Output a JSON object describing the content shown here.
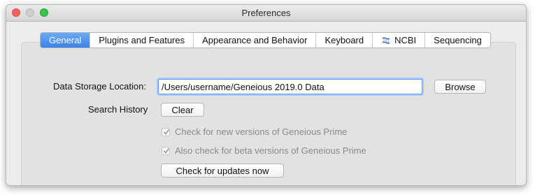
{
  "window": {
    "title": "Preferences"
  },
  "tabs": [
    {
      "label": "General",
      "active": true
    },
    {
      "label": "Plugins and Features",
      "active": false
    },
    {
      "label": "Appearance and Behavior",
      "active": false
    },
    {
      "label": "Keyboard",
      "active": false
    },
    {
      "label": "NCBI",
      "active": false,
      "icon": "ncbi-icon"
    },
    {
      "label": "Sequencing",
      "active": false
    }
  ],
  "general": {
    "data_storage_label": "Data Storage Location:",
    "data_storage_value": "/Users/username/Geneious 2019.0 Data",
    "browse_label": "Browse",
    "search_history_label": "Search History",
    "clear_label": "Clear",
    "check_new_versions_label": "Check for new versions of Geneious Prime",
    "check_new_versions_checked": true,
    "check_beta_label": "Also check for beta versions of Geneious Prime",
    "check_beta_checked": true,
    "check_updates_label": "Check for updates now"
  },
  "colors": {
    "accent": "#3b82e8",
    "focus_ring": "#a9cbf7",
    "close": "#fc605c",
    "maximize": "#35c94a"
  }
}
